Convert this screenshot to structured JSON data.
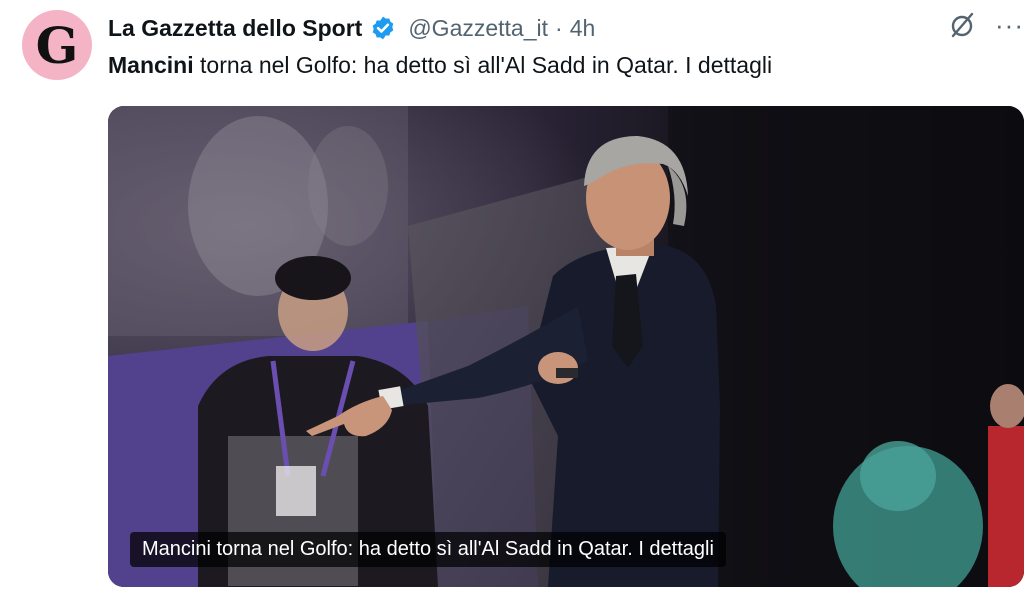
{
  "tweet": {
    "avatar_letter": "G",
    "author_name": "La Gazzetta dello Sport",
    "handle": "@Gazzetta_it",
    "separator": "·",
    "time": "4h",
    "text_bold": "Mancini",
    "text_rest": " torna nel Golfo: ha detto sì all'Al Sadd in Qatar. I dettagli",
    "more_label": "···"
  },
  "card": {
    "caption": "Mancini torna nel Golfo: ha detto sì all'Al Sadd in Qatar. I dettagli"
  },
  "icons": {
    "verified": "verified-badge-icon",
    "grok": "grok-icon",
    "more": "more-options-icon"
  },
  "colors": {
    "verified": "#1d9bf0",
    "avatar_bg": "#f4b4c6",
    "secondary_text": "#536471"
  }
}
